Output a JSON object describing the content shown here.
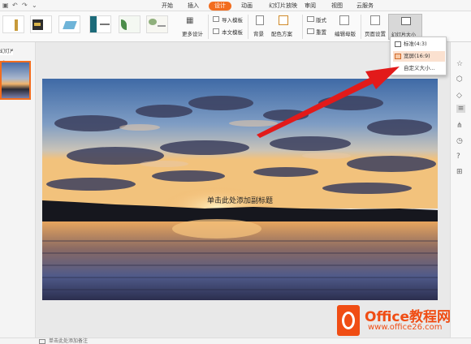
{
  "menu_tabs": [
    "开始",
    "插入",
    "设计",
    "动画",
    "幻灯片放映",
    "审阅",
    "视图",
    "云服务"
  ],
  "ribbon": {
    "more_design": "更多设计",
    "import_template": "导入模板",
    "text_template": "本文模板",
    "background": "背景",
    "color_scheme": "配色方案",
    "layout": "版式",
    "rearrange": "重置",
    "edit_master": "编辑母版",
    "page_setup": "页面设置",
    "slide_size": "幻灯片大小"
  },
  "dropdown": {
    "items": [
      "标准(4:3)",
      "宽屏(16:9)",
      "自定义大小..."
    ]
  },
  "left_panel": {
    "tab": "幻灯片"
  },
  "slide": {
    "subtitle": "单击此处添加副标题"
  },
  "notes_placeholder": "单击此处添加备注",
  "watermark": {
    "brand_title": "Office教程网",
    "url": "www.office26.com"
  },
  "colors": {
    "accent": "#f26d1f",
    "watermark_orange": "#f04d14",
    "arrow": "#e21a1a"
  }
}
